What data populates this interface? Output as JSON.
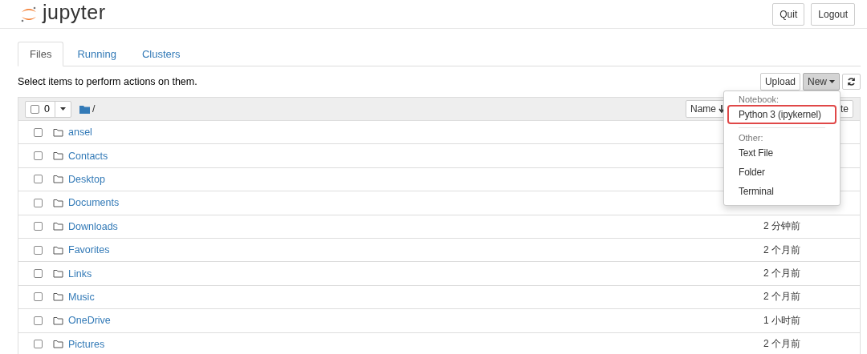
{
  "header": {
    "logo_text": "jupyter",
    "buttons": [
      "Quit",
      "Logout"
    ]
  },
  "tabs": [
    {
      "label": "Files",
      "selected": true
    },
    {
      "label": "Running",
      "selected": false
    },
    {
      "label": "Clusters",
      "selected": false
    }
  ],
  "toolbar": {
    "hint": "Select items to perform actions on them.",
    "upload": "Upload",
    "new": "New"
  },
  "list_header": {
    "checked": false,
    "selected_count": "0",
    "path": "/",
    "sort_button": "Name",
    "column_3": "te"
  },
  "rows": [
    {
      "name": "ansel",
      "checked": false
    },
    {
      "name": "Contacts",
      "checked": false
    },
    {
      "name": "Desktop",
      "checked": false
    },
    {
      "name": "Documents",
      "checked": false
    },
    {
      "name": "Downloads",
      "checked": false,
      "modified": "2 分钟前"
    },
    {
      "name": "Favorites",
      "checked": false,
      "modified": "2 个月前"
    },
    {
      "name": "Links",
      "checked": false,
      "modified": "2 个月前"
    },
    {
      "name": "Music",
      "checked": false,
      "modified": "2 个月前"
    },
    {
      "name": "OneDrive",
      "checked": false,
      "modified": "1 小时前"
    },
    {
      "name": "Pictures",
      "checked": false,
      "modified": "2 个月前"
    }
  ],
  "new_menu": {
    "items": [
      {
        "kind": "header",
        "label": "Notebook:"
      },
      {
        "kind": "item",
        "label": "Python 3 (ipykernel)",
        "highlighted": true
      },
      {
        "kind": "divider"
      },
      {
        "kind": "header",
        "label": "Other:"
      },
      {
        "kind": "item",
        "label": "Text File",
        "highlighted": false
      },
      {
        "kind": "item",
        "label": "Folder",
        "highlighted": false
      },
      {
        "kind": "item",
        "label": "Terminal",
        "highlighted": false
      }
    ]
  }
}
